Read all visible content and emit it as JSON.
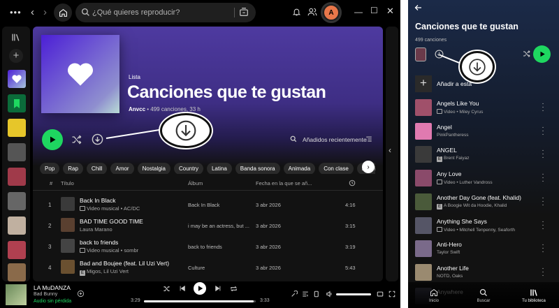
{
  "desktop": {
    "search_placeholder": "¿Qué quieres reproducir?",
    "avatar_letter": "A",
    "playlist": {
      "type_label": "Lista",
      "title": "Canciones que te gustan",
      "owner": "Anvcc",
      "meta": " • 499 canciones, 33 h"
    },
    "sort_label": "Añadidos recientemente",
    "chips": [
      "Pop",
      "Rap",
      "Chill",
      "Amor",
      "Nostalgia",
      "Country",
      "Latina",
      "Banda sonora",
      "Animada",
      "Con clase",
      "Espiritu"
    ],
    "table_headers": {
      "num": "#",
      "title": "Título",
      "album": "Álbum",
      "date": "Fecha en la que se añ..."
    },
    "tracks": [
      {
        "num": "1",
        "title": "Back In Black",
        "artist": "Video musical • AC/DC",
        "badge": "video",
        "album": "Back In Black",
        "date": "3 abr 2026",
        "duration": "4:16",
        "color": "#3a3a3a"
      },
      {
        "num": "2",
        "title": "BAD TIME GOOD TIME",
        "artist": "Laura Marano",
        "badge": "",
        "album": "i may be an actress, but ...",
        "date": "3 abr 2026",
        "duration": "3:15",
        "color": "#5a4030"
      },
      {
        "num": "3",
        "title": "back to friends",
        "artist": "Video musical • sombr",
        "badge": "video",
        "album": "back to friends",
        "date": "3 abr 2026",
        "duration": "3:19",
        "color": "#444"
      },
      {
        "num": "4",
        "title": "Bad and Boujee (feat. Lil Uzi Vert)",
        "artist": "Migos, Lil Uzi Vert",
        "badge": "explicit",
        "album": "Culture",
        "date": "3 abr 2026",
        "duration": "5:43",
        "color": "#6a5030"
      }
    ],
    "now_playing": {
      "title": "LA MuDANZA",
      "artist": "Bad Bunny",
      "quality": "Audio sin pérdida",
      "elapsed": "3:29",
      "total": "3:33",
      "progress": 0.98
    }
  },
  "mobile": {
    "title": "Canciones que te gustan",
    "count": "499 canciones",
    "add_label": "Añadir a esta",
    "tracks": [
      {
        "title": "Angels Like You",
        "artist": "Video • Miley Cyrus",
        "badge": "video",
        "color": "#a0506a"
      },
      {
        "title": "Angel",
        "artist": "PinkPantheress",
        "badge": "",
        "color": "#e07ab0"
      },
      {
        "title": "ANGEL",
        "artist": "Brent Faiyaz",
        "badge": "explicit",
        "color": "#3a3a3a"
      },
      {
        "title": "Any Love",
        "artist": "Video • Luther Vandross",
        "badge": "video",
        "color": "#8a4a6a"
      },
      {
        "title": "Another Day Gone (feat. Khalid)",
        "artist": "A Boogie Wit da Hoodie, Khalid",
        "badge": "explicit",
        "color": "#4a5a3a"
      },
      {
        "title": "Anything She Says",
        "artist": "Video • Mitchell Tenpenny, Seaforth",
        "badge": "video",
        "color": "#556"
      },
      {
        "title": "Anti-Hero",
        "artist": "Taylor Swift",
        "badge": "",
        "color": "#7a6a8a"
      },
      {
        "title": "Another Life",
        "artist": "NOTD, Oaks",
        "badge": "",
        "color": "#9a8a70"
      },
      {
        "title": "Anywhere",
        "artist": "",
        "badge": "",
        "color": "#445"
      }
    ],
    "nav": {
      "home": "Inicio",
      "search": "Buscar",
      "library": "Tu biblioteca"
    }
  }
}
